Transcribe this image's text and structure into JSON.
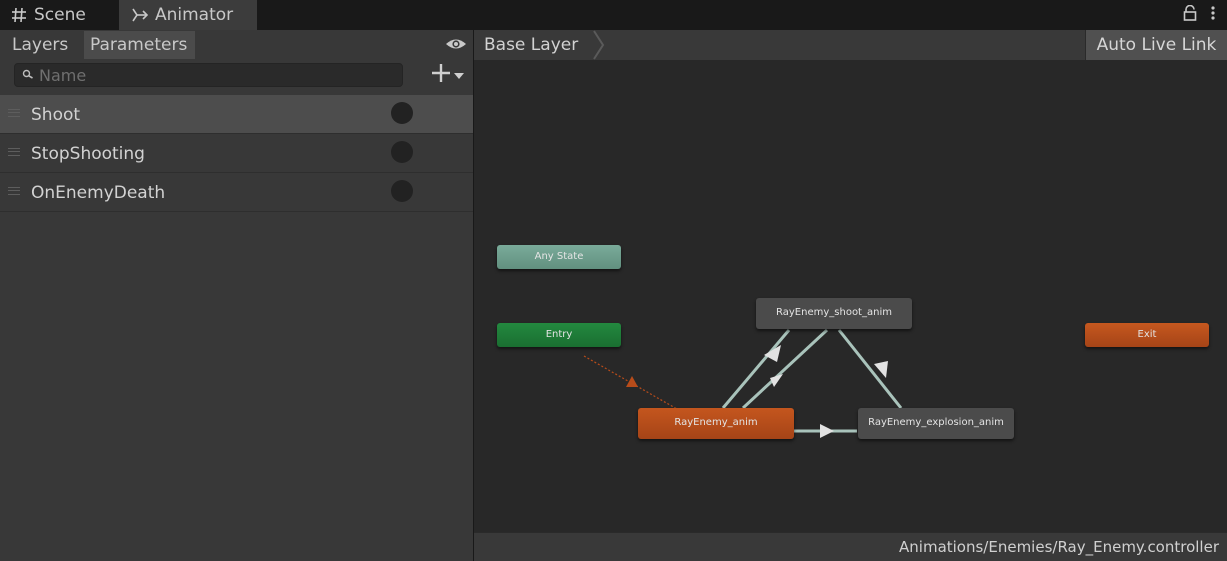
{
  "tabs": {
    "scene": {
      "label": "Scene",
      "icon": "grid-icon"
    },
    "animator": {
      "label": "Animator",
      "icon": "animator-icon"
    }
  },
  "window_icons": [
    "lock-icon",
    "more-menu-icon"
  ],
  "left_panel": {
    "tabs": {
      "layers": "Layers",
      "parameters": "Parameters"
    },
    "visibility_icon": "eye-icon",
    "search": {
      "placeholder": "Name",
      "value": ""
    },
    "add_icon": "plus-dropdown-icon",
    "parameters": [
      {
        "name": "Shoot",
        "type": "trigger",
        "selected": true
      },
      {
        "name": "StopShooting",
        "type": "trigger",
        "selected": false
      },
      {
        "name": "OnEnemyDeath",
        "type": "trigger",
        "selected": false
      }
    ]
  },
  "graph": {
    "breadcrumb": "Base Layer",
    "live_link": "Auto Live Link",
    "states": {
      "any_state": {
        "label": "Any State",
        "color": "#6d9a8a"
      },
      "entry": {
        "label": "Entry",
        "color": "#1d7a37"
      },
      "exit": {
        "label": "Exit",
        "color": "#b84c1a"
      },
      "shoot": {
        "label": "RayEnemy_shoot_anim",
        "color": "#4a4a4a"
      },
      "ray_enemy": {
        "label": "RayEnemy_anim",
        "color": "#b84c1a",
        "default": true
      },
      "explosion": {
        "label": "RayEnemy_explosion_anim",
        "color": "#4a4a4a"
      }
    }
  },
  "status": {
    "path": "Animations/Enemies/Ray_Enemy.controller"
  },
  "colors": {
    "transition": "#a9c3bb",
    "default_transition": "#b84c1a",
    "selected_row": "#4d4d4d"
  }
}
